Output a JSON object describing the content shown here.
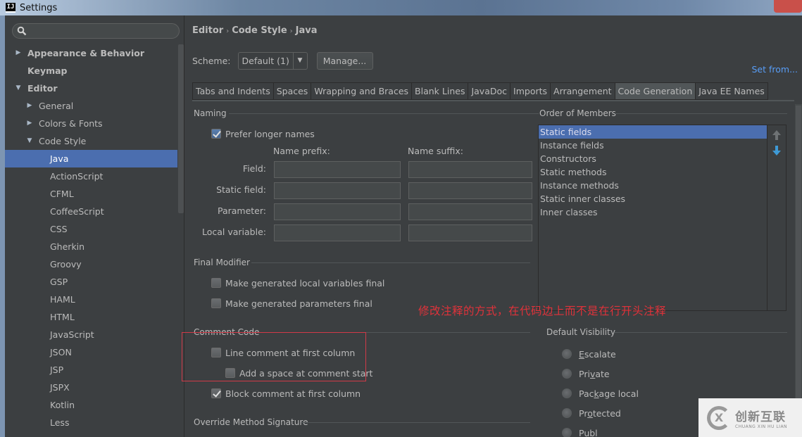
{
  "window": {
    "app_icon": "IJ",
    "title": "Settings"
  },
  "sidebar": {
    "search_placeholder": "",
    "items": [
      {
        "label": "Appearance & Behavior",
        "arrow": "▶",
        "bold": true
      },
      {
        "label": "Keymap",
        "arrow": "",
        "bold": true
      },
      {
        "label": "Editor",
        "arrow": "▼",
        "bold": true
      },
      {
        "label": "General",
        "arrow": "▶"
      },
      {
        "label": "Colors & Fonts",
        "arrow": "▶"
      },
      {
        "label": "Code Style",
        "arrow": "▼"
      },
      {
        "label": "Java",
        "selected": true
      },
      {
        "label": "ActionScript"
      },
      {
        "label": "CFML"
      },
      {
        "label": "CoffeeScript"
      },
      {
        "label": "CSS"
      },
      {
        "label": "Gherkin"
      },
      {
        "label": "Groovy"
      },
      {
        "label": "GSP"
      },
      {
        "label": "HAML"
      },
      {
        "label": "HTML"
      },
      {
        "label": "JavaScript"
      },
      {
        "label": "JSON"
      },
      {
        "label": "JSP"
      },
      {
        "label": "JSPX"
      },
      {
        "label": "Kotlin"
      },
      {
        "label": "Less"
      }
    ]
  },
  "breadcrumb": [
    "Editor",
    "Code Style",
    "Java"
  ],
  "breadcrumb_sep": "›",
  "scheme": {
    "label": "Scheme:",
    "value": "Default (1)",
    "manage_label": "Manage...",
    "dropdown_glyph": "▼"
  },
  "set_from_label": "Set from...",
  "tabs": [
    {
      "label": "Tabs and Indents"
    },
    {
      "label": "Spaces"
    },
    {
      "label": "Wrapping and Braces"
    },
    {
      "label": "Blank Lines"
    },
    {
      "label": "JavaDoc"
    },
    {
      "label": "Imports"
    },
    {
      "label": "Arrangement"
    },
    {
      "label": "Code Generation",
      "active": true
    },
    {
      "label": "Java EE Names"
    }
  ],
  "naming": {
    "title": "Naming",
    "prefer_longer": {
      "label": "Prefer longer names",
      "checked": true
    },
    "prefix_header": "Name prefix:",
    "suffix_header": "Name suffix:",
    "rows": [
      {
        "label": "Field:",
        "prefix": "",
        "suffix": ""
      },
      {
        "label": "Static field:",
        "prefix": "",
        "suffix": ""
      },
      {
        "label": "Parameter:",
        "prefix": "",
        "suffix": ""
      },
      {
        "label": "Local variable:",
        "prefix": "",
        "suffix": ""
      }
    ]
  },
  "order_of_members": {
    "title": "Order of Members",
    "items": [
      {
        "label": "Static fields",
        "selected": true
      },
      {
        "label": "Instance fields"
      },
      {
        "label": "Constructors"
      },
      {
        "label": "Static methods"
      },
      {
        "label": "Instance methods"
      },
      {
        "label": "Static inner classes"
      },
      {
        "label": "Inner classes"
      }
    ]
  },
  "final_modifier": {
    "title": "Final Modifier",
    "options": [
      {
        "label": "Make generated local variables final",
        "checked": false
      },
      {
        "label": "Make generated parameters final",
        "checked": false
      }
    ]
  },
  "comment_code": {
    "title": "Comment Code",
    "options": [
      {
        "label": "Line comment at first column",
        "checked": false
      },
      {
        "label": "Add a space at comment start",
        "checked": false
      },
      {
        "label": "Block comment at first column",
        "checked": true
      }
    ]
  },
  "override_method_signature": {
    "title": "Override Method Signature"
  },
  "default_visibility": {
    "title": "Default Visibility",
    "options": [
      {
        "pre": "",
        "u": "E",
        "post": "scalate"
      },
      {
        "pre": "Pri",
        "u": "v",
        "post": "ate"
      },
      {
        "pre": "Pac",
        "u": "k",
        "post": "age local"
      },
      {
        "pre": "Pr",
        "u": "o",
        "post": "tected"
      },
      {
        "pre": "Publ",
        "u": "",
        "post": ""
      }
    ]
  },
  "annotation_text": "修改注释的方式，在代码边上而不是在行开头注释",
  "watermark": {
    "logo_glyph": "X",
    "cn": "创新互联",
    "en": "CHUANG XIN HU LIAN"
  },
  "colors": {
    "selection": "#4b6eaf",
    "link": "#589df6",
    "annotation": "#e0323a"
  }
}
